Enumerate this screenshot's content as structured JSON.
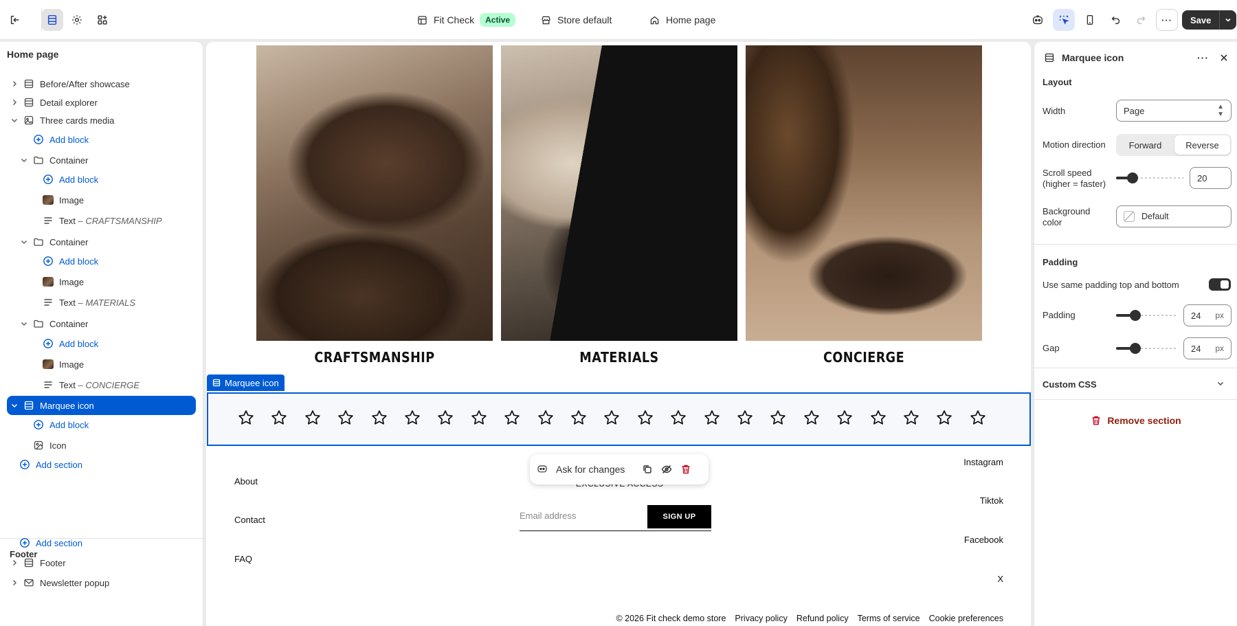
{
  "topbar": {
    "theme_name": "Fit Check",
    "status": "Active",
    "store": "Store default",
    "page": "Home page",
    "save_label": "Save"
  },
  "left_panel": {
    "title": "Home page",
    "tree": [
      {
        "label": "Before/After showcase",
        "icon": "section-icon",
        "type": "section"
      },
      {
        "label": "Detail explorer",
        "icon": "section-icon",
        "type": "section"
      },
      {
        "label": "Three cards media",
        "icon": "media-icon",
        "type": "section-open"
      },
      {
        "label": "Add block",
        "type": "add"
      },
      {
        "label": "Container",
        "icon": "folder-icon",
        "type": "group"
      },
      {
        "label": "Add block",
        "type": "add"
      },
      {
        "label": "Image",
        "type": "image"
      },
      {
        "label": "Text",
        "sub": "CRAFTSMANSHIP",
        "type": "text"
      },
      {
        "label": "Container",
        "icon": "folder-icon",
        "type": "group"
      },
      {
        "label": "Add block",
        "type": "add"
      },
      {
        "label": "Image",
        "type": "image"
      },
      {
        "label": "Text",
        "sub": "MATERIALS",
        "type": "text"
      },
      {
        "label": "Container",
        "icon": "folder-icon",
        "type": "group"
      },
      {
        "label": "Add block",
        "type": "add"
      },
      {
        "label": "Image",
        "type": "image"
      },
      {
        "label": "Text",
        "sub": "CONCIERGE",
        "type": "text"
      },
      {
        "label": "Marquee icon",
        "icon": "section-icon",
        "type": "selected"
      },
      {
        "label": "Add block",
        "type": "add"
      },
      {
        "label": "Icon",
        "icon": "icon-block-icon",
        "type": "leaf"
      },
      {
        "label": "Add section",
        "type": "add-section"
      }
    ],
    "footer_title": "Footer",
    "footer_tree": [
      {
        "label": "Add section",
        "type": "add-section"
      },
      {
        "label": "Footer",
        "icon": "section-icon",
        "type": "section"
      },
      {
        "label": "Newsletter popup",
        "icon": "mail-icon",
        "type": "section"
      }
    ]
  },
  "canvas": {
    "cards": [
      "CRAFTSMANSHIP",
      "MATERIALS",
      "CONCIERGE"
    ],
    "marquee_tag": "Marquee icon",
    "star_count": 23,
    "footer_left": [
      "About",
      "Contact",
      "FAQ"
    ],
    "footer_right": [
      "Instagram",
      "Tiktok",
      "Facebook",
      "X"
    ],
    "ask_label": "Ask for changes",
    "exclusive": "EXCLUSIVE ACCESS",
    "email_placeholder": "Email address",
    "signup_label": "SIGN UP",
    "bottom_links": [
      "© 2026 Fit check demo store",
      "Privacy policy",
      "Refund policy",
      "Terms of service",
      "Cookie preferences"
    ]
  },
  "right_panel": {
    "title": "Marquee icon",
    "layout_title": "Layout",
    "width_label": "Width",
    "width_value": "Page",
    "motion_label": "Motion direction",
    "motion_options": [
      "Forward",
      "Reverse"
    ],
    "motion_selected": "Reverse",
    "speed_label_1": "Scroll speed",
    "speed_label_2": "(higher = faster)",
    "speed_value": "20",
    "speed_fraction": 0.2,
    "bg_label_1": "Background",
    "bg_label_2": "color",
    "bg_value": "Default",
    "padding_title": "Padding",
    "same_padding_label": "Use same padding top and bottom",
    "padding_label": "Padding",
    "padding_value": "24",
    "padding_fraction": 0.27,
    "gap_label": "Gap",
    "gap_value": "24",
    "gap_fraction": 0.27,
    "unit": "px",
    "custom_css_label": "Custom CSS",
    "remove_label": "Remove section"
  },
  "colors": {
    "accent": "#005bd3",
    "danger": "#c70a24",
    "active_badge": "#b4fed2"
  }
}
